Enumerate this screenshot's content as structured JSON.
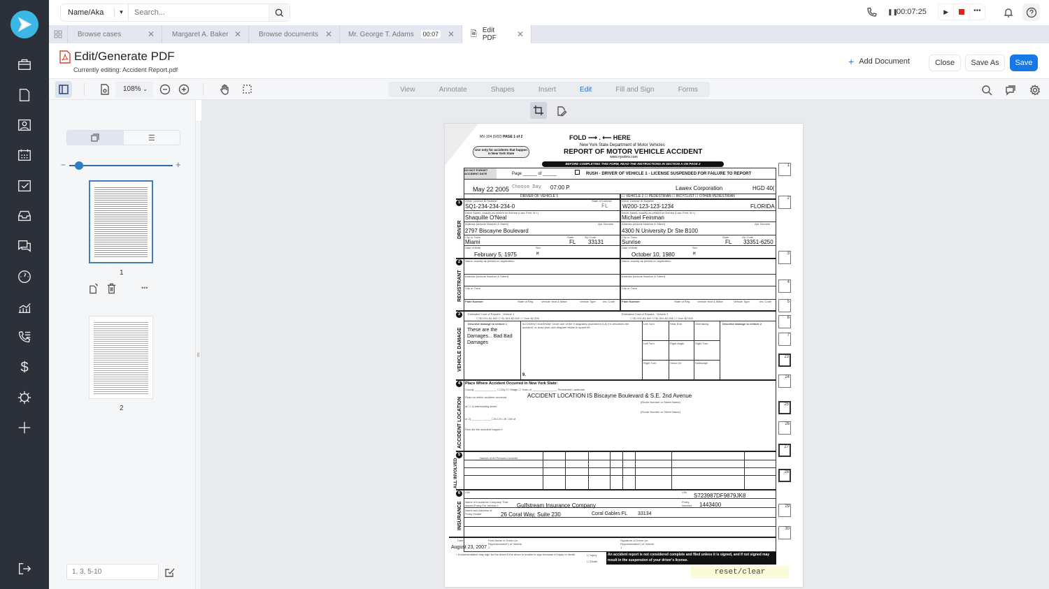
{
  "search": {
    "filter": "Name/Aka",
    "placeholder": "Search..."
  },
  "call": {
    "timer": "00:07:25"
  },
  "tabs": [
    {
      "label": "Browse cases"
    },
    {
      "label": "Margaret A. Baker"
    },
    {
      "label": "Browse documents"
    },
    {
      "label": "Mr. George T. Adams",
      "badge": "00:07"
    },
    {
      "label": "Edit PDF"
    }
  ],
  "header": {
    "title": "Edit/Generate PDF",
    "subtitle": "Currently editing: Accident Report.pdf",
    "add_document": "Add Document",
    "close": "Close",
    "save_as": "Save As",
    "save": "Save"
  },
  "toolbar": {
    "zoom": "108%",
    "modes": [
      "View",
      "Annotate",
      "Shapes",
      "Insert",
      "Edit",
      "Fill and Sign",
      "Forms"
    ],
    "active_mode": "Edit"
  },
  "thumbnails": {
    "pages": [
      "1",
      "2"
    ],
    "page_range_placeholder": "1, 3, 5-10",
    "slider_value": 0.1
  },
  "pdf": {
    "form_id": "MV-104 (5/02)",
    "page_label": "PAGE 1 of 2",
    "fold": "FOLD ⟶ . ⟵ HERE",
    "dept": "New York State Department of Motor Vehicles",
    "title": "REPORT OF MOTOR VEHICLE ACCIDENT",
    "url": "www.nysdmv.com",
    "banner": "BEFORE COMPLETING THIS FORM, READ THE INSTRUCTIONS IN SECTION A ON PAGE 2",
    "ny_only": "Use only for accidents that happen in New York State",
    "dont_forget": "DO NOT FORGET ACCIDENT DATE",
    "page_of": "Page ______ of ______",
    "rush": "RUSH - DRIVER OF VEHICLE 1 - LICENSE SUSPENDED FOR FAILURE TO REPORT",
    "accident_date": "May 22  2005",
    "day_of_week": "Choose Day",
    "time": "07:00 P",
    "police_agency": "Lawex Corporation",
    "accident_number": "HGD 40(",
    "driver1_header": "DRIVER OF VEHICLE 1",
    "vehicle2_header": "☐ VEHICLE 2   ☐ PEDESTRIAN   ☐ BICYCLIST   ☐ OTHER PEDESTRIAN",
    "labels": {
      "license": "Driver License ID Number",
      "state_license": "State of License",
      "name": "Driver Name–exactly as printed on license (Last, First, M.I.)",
      "address": "Address (include Number & Street)",
      "apt": "Apt. Number",
      "city": "City or Town",
      "state": "State",
      "zip": "Zip Code",
      "dob": "Date of Birth",
      "sex": "Sex",
      "reg_name": "Name–exactly as printed on registration",
      "plate": "Plate Number",
      "state_reg": "State of Reg.",
      "year_make": "Vehicle Year & Make",
      "veh_type": "Vehicle Type",
      "ins_code": "Ins. Code",
      "cost1": "Estimated Cost of Repairs - Vehicle 1",
      "cost2": "Estimated Cost of Repairs - Vehicle 2",
      "cost_opts": "☐ $1,001-$1,500      ☐ $1,501-$2,500      ☐ Over $2,500",
      "damage1": "Describe damage to vehicle 1",
      "damage2": "Describe damage to vehicle 2",
      "diagram": "ACCIDENT DIAGRAM: Circle one of the 9 diagrams (numbered 0-8) if it describes the accident, or draw your own diagram below in space #9.",
      "diagram_9": "9.",
      "place": "Place Where Accident Occurred in New York State:",
      "county": "County ______________   ☐ City  ☐ Village  ☐ Town  of ________________   Permanent Landmark",
      "road": "Road on which accident occurred",
      "route": "(Route Number or Street Name)",
      "intersect": "at ☐ 1) intersecting street",
      "or2": "or    2) ______  ______     ☐N ☐S  ☐E ☐W  of",
      "how": "How did the accident happen?",
      "persons": "Names of All Persons Involved",
      "vin": "VIN",
      "ins_co": "Name of Insurance Company That Issued Policy For Vehicle 1",
      "holder": "Name and Address of Policy Holder",
      "policy_no": "Policy Number",
      "date": "Date",
      "print_name": "Print Name of Driver (or Representative*) of Vehicle 1",
      "signature": "Signature of Driver (or Representative*) of Vehicle 1",
      "rep_note": "* A representative may sign for the driver if the driver is unable to sign because of injury or death.",
      "injury": "☐ Injury",
      "death": "☐ Death"
    },
    "sections": [
      "DRIVER",
      "REGISTRANT",
      "VEHICLE DAMAGE",
      "ACCIDENT LOCATION",
      "ALL INVOLVED",
      "INSURANCE"
    ],
    "driver1": {
      "license": "SQ1-234-234-234-0",
      "state": "FL",
      "name": "Shaquille O'Neal",
      "address": "2797 Biscayne Boulevard",
      "city": "Miami",
      "st": "FL",
      "zip": "33131",
      "dob": "February 5, 1975",
      "sex": "M"
    },
    "driver2": {
      "license": "W200-123-123-1234",
      "state": "FLORIDA",
      "name": "Michael Feinman",
      "address": "4300 N University Dr Ste B100",
      "city": "Sunrise",
      "st": "FL",
      "zip": "33351-6250",
      "dob": "October 10, 1980",
      "sex": "M"
    },
    "damage_text": [
      "These are the",
      "Damages... Bad Bad",
      "Damages"
    ],
    "diagram_cells": [
      "Left Turn",
      "Rear End",
      "Overtaking",
      "Left Turn",
      "Right Angle",
      "Right Turn",
      "Right Turn",
      "Head On",
      "Sideswipe"
    ],
    "road_value": "ACCIDENT LOCATION IS Biscayne Boulevard & S.E. 2nd Avenue",
    "vin_value": "S723987DF9879JK8",
    "insurance_company": "Gulfstream Insurance Company",
    "policy_number": "1443400",
    "holder_address": "26 Coral Way, Suite 230",
    "holder_city": "Coral Gables  FL",
    "holder_zip": "33134",
    "sign_date": "August 23, 2007",
    "warning": "An accident report is not considered complete and filed unless it is signed, and if not signed may result in the suspension of your driver's license.",
    "reset": "reset/clear",
    "side_boxes": [
      "1",
      "2",
      "3",
      "4",
      "5",
      "6",
      "7",
      "23",
      "24",
      "25",
      "26",
      "27",
      "28",
      "29",
      "30"
    ]
  }
}
